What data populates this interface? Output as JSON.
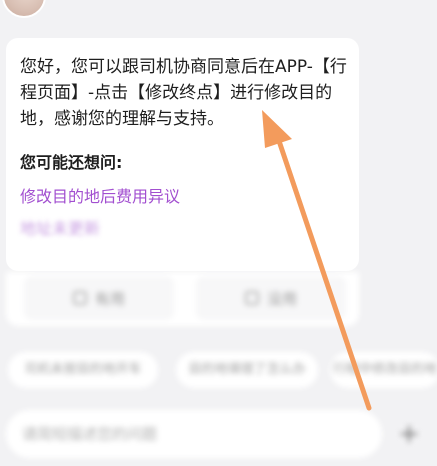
{
  "answer": {
    "text": "您好，您可以跟司机协商同意后在APP-【行程页面】-点击【修改终点】进行修改目的地，感谢您的理解与支持。"
  },
  "suggestions": {
    "title": "您可能还想问:",
    "items": [
      "修改目的地后费用异议",
      "地址未更新"
    ]
  },
  "feedback": {
    "like_label": "有用",
    "dislike_label": "没用"
  },
  "quick_chips": [
    "司机未按目的地开车",
    "目的地填错了怎么办",
    "行程中修改目的地"
  ],
  "input": {
    "placeholder": "请简短描述您的问题"
  },
  "colors": {
    "link": "#a24fd0",
    "annotation_arrow": "#f39b5c"
  },
  "icons": {
    "like": "thumbs-up-icon",
    "dislike": "thumbs-down-icon",
    "add": "plus-icon"
  }
}
